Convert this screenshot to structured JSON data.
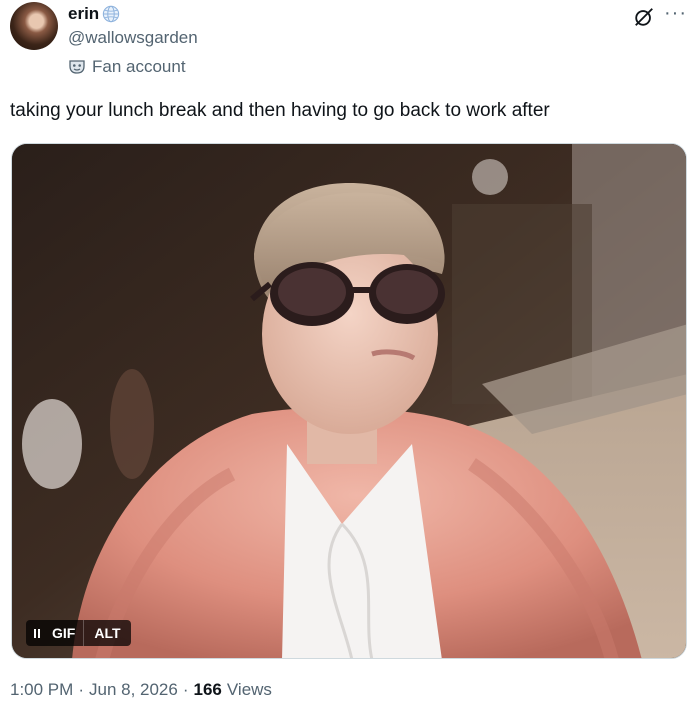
{
  "author": {
    "display_name": "erin",
    "handle": "@wallowsgarden",
    "label": "Fan account",
    "verified_icon": "globe-verified-icon",
    "label_icon": "mask-icon"
  },
  "actions": {
    "grok_icon": "grok-icon",
    "more_label": "···"
  },
  "tweet": {
    "text": "taking your lunch break and then having to go back to work after"
  },
  "media": {
    "type": "gif",
    "pause_icon": "pause-icon",
    "gif_label": "GIF",
    "alt_label": "ALT"
  },
  "meta": {
    "time": "1:00 PM",
    "separator": "·",
    "date": "Jun 8, 2026",
    "views_count": "166",
    "views_label": "Views"
  },
  "colors": {
    "text_primary": "#0f1419",
    "text_secondary": "#536471",
    "border": "#cfd9de"
  }
}
